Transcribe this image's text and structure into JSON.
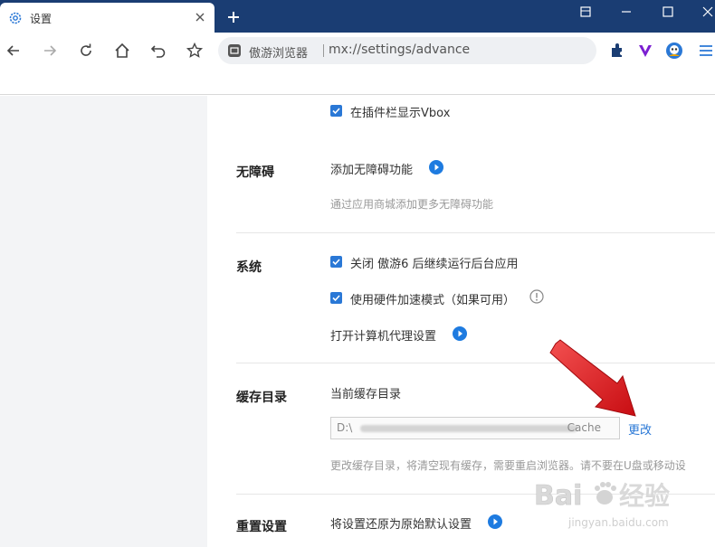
{
  "tab": {
    "title": "设置",
    "icon": "gear-icon"
  },
  "omnibox": {
    "site_name": "傲游浏览器",
    "url": "mx://settings/advance"
  },
  "sections": {
    "plugins": {
      "vbox_label": "在插件栏显示Vbox",
      "checked": true
    },
    "accessibility": {
      "title": "无障碍",
      "add_label": "添加无障碍功能",
      "desc": "通过应用商城添加更多无障碍功能"
    },
    "system": {
      "title": "系统",
      "close_bg_label": "关闭 傲游6 后继续运行后台应用",
      "hw_accel_label": "使用硬件加速模式（如果可用）",
      "proxy_label": "打开计算机代理设置"
    },
    "cache": {
      "title": "缓存目录",
      "current_label": "当前缓存目录",
      "path_prefix": "D:\\",
      "path_suffix": "Cache",
      "change_label": "更改",
      "desc": "更改缓存目录，将清空现有缓存，需要重启浏览器。请不要在U盘或移动设"
    },
    "reset": {
      "title": "重置设置",
      "restore_label": "将设置还原为原始默认设置"
    }
  },
  "watermark": {
    "brand": "Baidu 经验",
    "url": "jingyan.baidu.com"
  },
  "colors": {
    "titlebar": "#1a3d73",
    "accent": "#2a78d6",
    "arrow": "#e0141b"
  }
}
